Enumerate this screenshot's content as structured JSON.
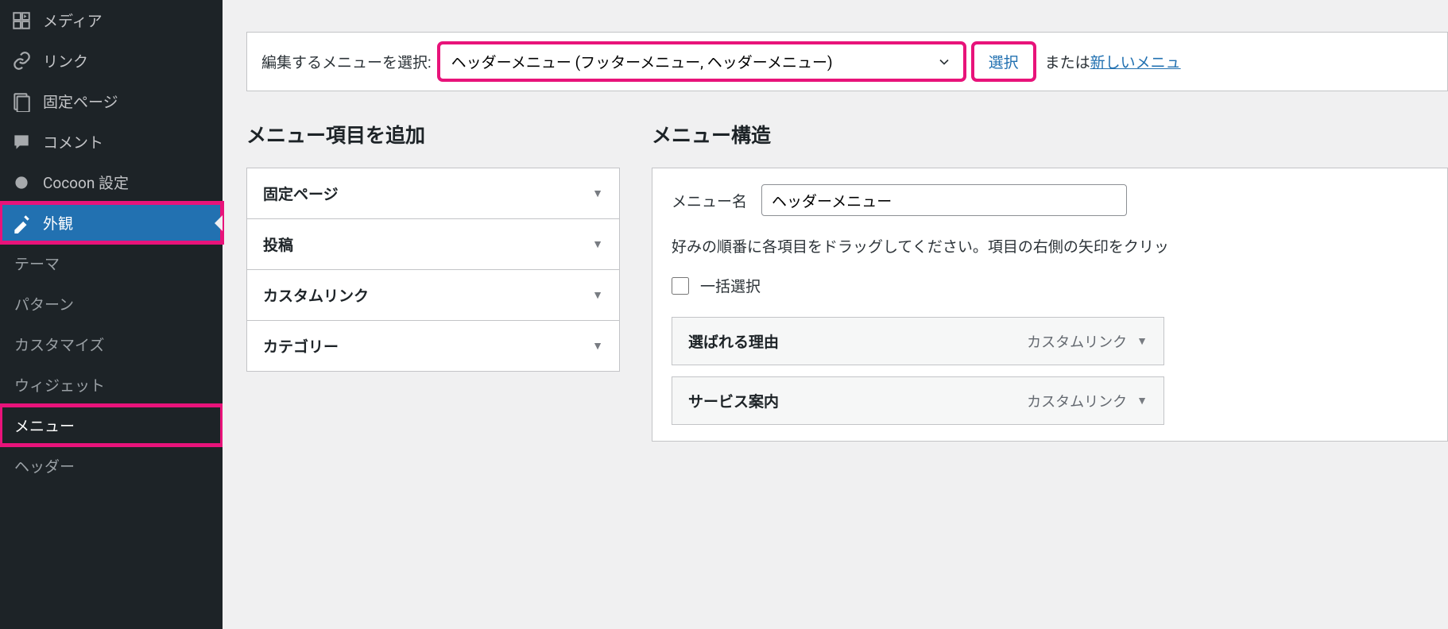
{
  "sidebar": {
    "media": "メディア",
    "links": "リンク",
    "pages": "固定ページ",
    "comments": "コメント",
    "cocoon": "Cocoon 設定",
    "appearance": "外観",
    "sub": {
      "themes": "テーマ",
      "patterns": "パターン",
      "customize": "カスタマイズ",
      "widgets": "ウィジェット",
      "menus": "メニュー",
      "header": "ヘッダー"
    }
  },
  "select_bar": {
    "label": "編集するメニューを選択:",
    "value": "ヘッダーメニュー (フッターメニュー, ヘッダーメニュー)",
    "button": "選択",
    "or": "または",
    "new_link": "新しいメニュ"
  },
  "add_items": {
    "heading": "メニュー項目を追加",
    "items": [
      "固定ページ",
      "投稿",
      "カスタムリンク",
      "カテゴリー"
    ]
  },
  "structure": {
    "heading": "メニュー構造",
    "name_label": "メニュー名",
    "name_value": "ヘッダーメニュー",
    "desc": "好みの順番に各項目をドラッグしてください。項目の右側の矢印をクリッ",
    "bulk_label": "一括選択",
    "items": [
      {
        "title": "選ばれる理由",
        "type": "カスタムリンク"
      },
      {
        "title": "サービス案内",
        "type": "カスタムリンク"
      }
    ]
  }
}
